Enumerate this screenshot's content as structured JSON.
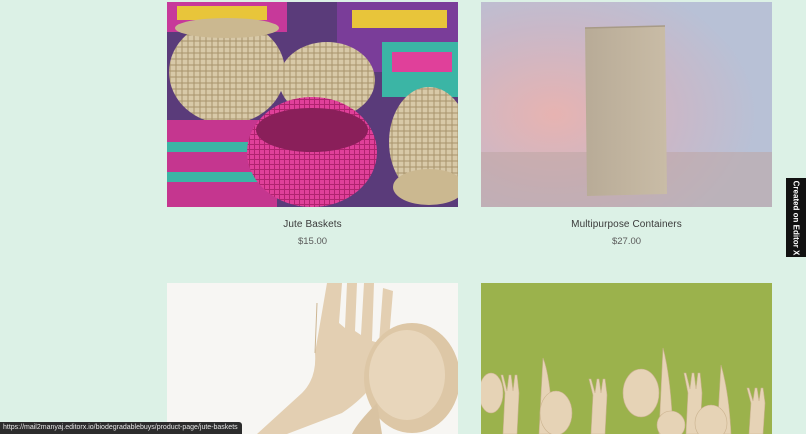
{
  "products": [
    {
      "title": "Jute Baskets",
      "price": "$15.00",
      "image": "woven-baskets-photo"
    },
    {
      "title": "Multipurpose Containers",
      "price": "$27.00",
      "image": "kraft-box-photo"
    },
    {
      "title": "",
      "price": "",
      "image": "wooden-cutlery-photo"
    },
    {
      "title": "",
      "price": "",
      "image": "wooden-cutlery-green-photo"
    }
  ],
  "badge": {
    "label": "Created on Editor X"
  },
  "status_bar": {
    "url": "https://mail2manyaj.editorx.io/biodegradablebuys/product-page/jute-baskets"
  },
  "colors": {
    "page_background": "#dcf1e6",
    "badge_background": "#111111",
    "accent_pink": "#e0409a",
    "accent_teal": "#3bb5a5",
    "green_backdrop": "#9bb24c"
  }
}
